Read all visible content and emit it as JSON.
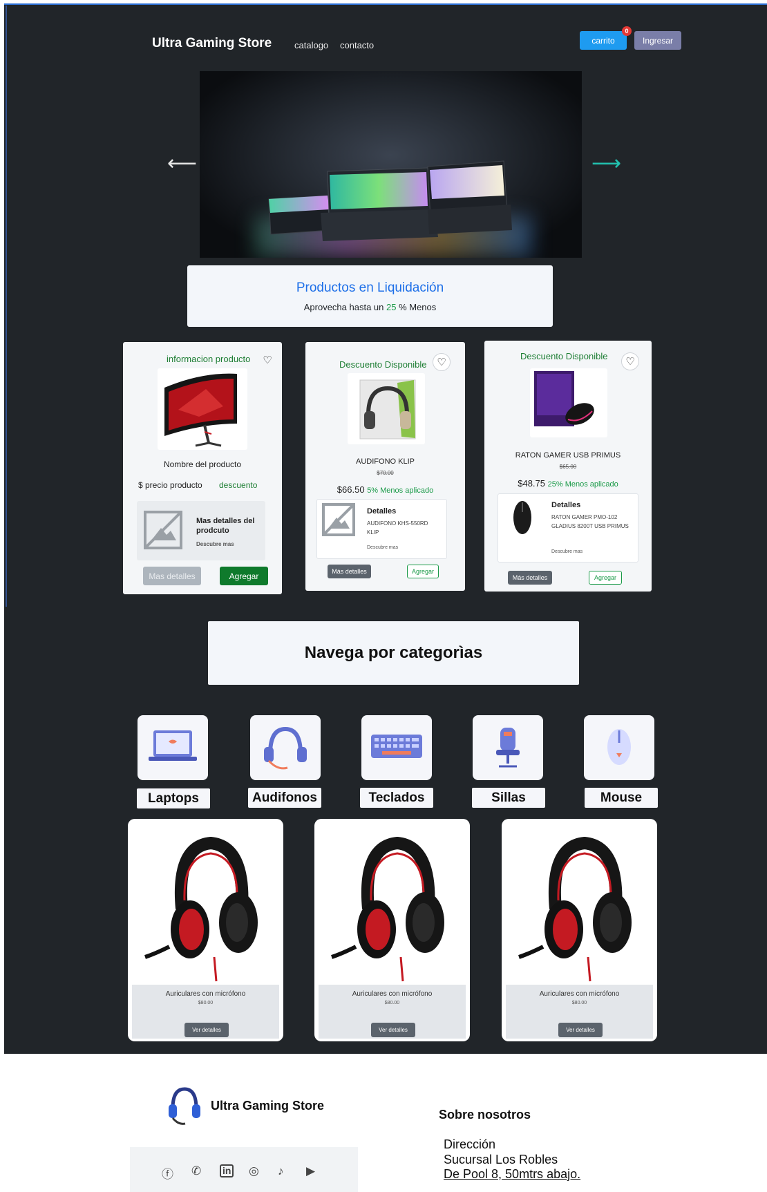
{
  "navbar": {
    "brand": "Ultra Gaming Store",
    "links": [
      "catalogo",
      "contacto"
    ],
    "cart_label": "carrito",
    "cart_count": "0",
    "login_label": "Ingresar"
  },
  "carousel": {
    "prev": "⟵",
    "next": "⟶"
  },
  "promo": {
    "title": "Productos en Liquidación",
    "sub_before": "Aprovecha hasta un ",
    "sub_pct": "25",
    "sub_after": " % Menos"
  },
  "products": [
    {
      "tag": "informacion producto",
      "name": "Nombre del producto",
      "price": "$ precio producto",
      "discount": "descuento",
      "detail_title": "Mas detalles del prodcuto",
      "detail_more": "Descubre mas",
      "btn_more": "Mas detalles",
      "btn_add": "Agregar"
    },
    {
      "tag": "Descuento Disponible",
      "name": "AUDIFONO KLIP",
      "old_price": "$70.00",
      "price": "$66.50",
      "discount": "5% Menos aplicado",
      "detail_title": "Detalles",
      "detail_text": "AUDIFONO KHS-550RD KLIP",
      "detail_more": "Descubre mas",
      "btn_more": "Más detalles",
      "btn_add": "Agregar"
    },
    {
      "tag": "Descuento Disponible",
      "name": "RATON GAMER USB PRIMUS",
      "old_price": "$65.00",
      "price": "$48.75",
      "discount": "25% Menos aplicado",
      "detail_title": "Detalles",
      "detail_text": "RATON GAMER PMO-102 GLADIUS 8200T USB PRIMUS",
      "detail_more": "Descubre mas",
      "btn_more": "Más detalles",
      "btn_add": "Agregar"
    }
  ],
  "categories": {
    "title": "Navega por categorìas",
    "items": [
      "Laptops",
      "Audifonos",
      "Teclados",
      "Sillas",
      "Mouse"
    ]
  },
  "featured": [
    {
      "name": "Auriculares con micrófono",
      "price": "$80.00",
      "btn": "Ver detalles"
    },
    {
      "name": "Auriculares con micrófono",
      "price": "$80.00",
      "btn": "Ver detalles"
    },
    {
      "name": "Auriculares con micrófono",
      "price": "$80.00",
      "btn": "Ver detalles"
    }
  ],
  "footer": {
    "brand": "Ultra Gaming Store",
    "about": "Sobre nosotros",
    "address": [
      "Dirección",
      "Sucursal Los Robles",
      "De Pool 8, 50mtrs abajo."
    ],
    "social": [
      "facebook-icon",
      "whatsapp-icon",
      "linkedin-icon",
      "instagram-icon",
      "tiktok-icon",
      "youtube-icon"
    ]
  },
  "colors": {
    "dark_bg": "#212529",
    "accent_blue": "#1d6fe8",
    "green": "#1a9a48",
    "cart_btn": "#1e9bf0",
    "login_btn": "#7a7ea8"
  }
}
